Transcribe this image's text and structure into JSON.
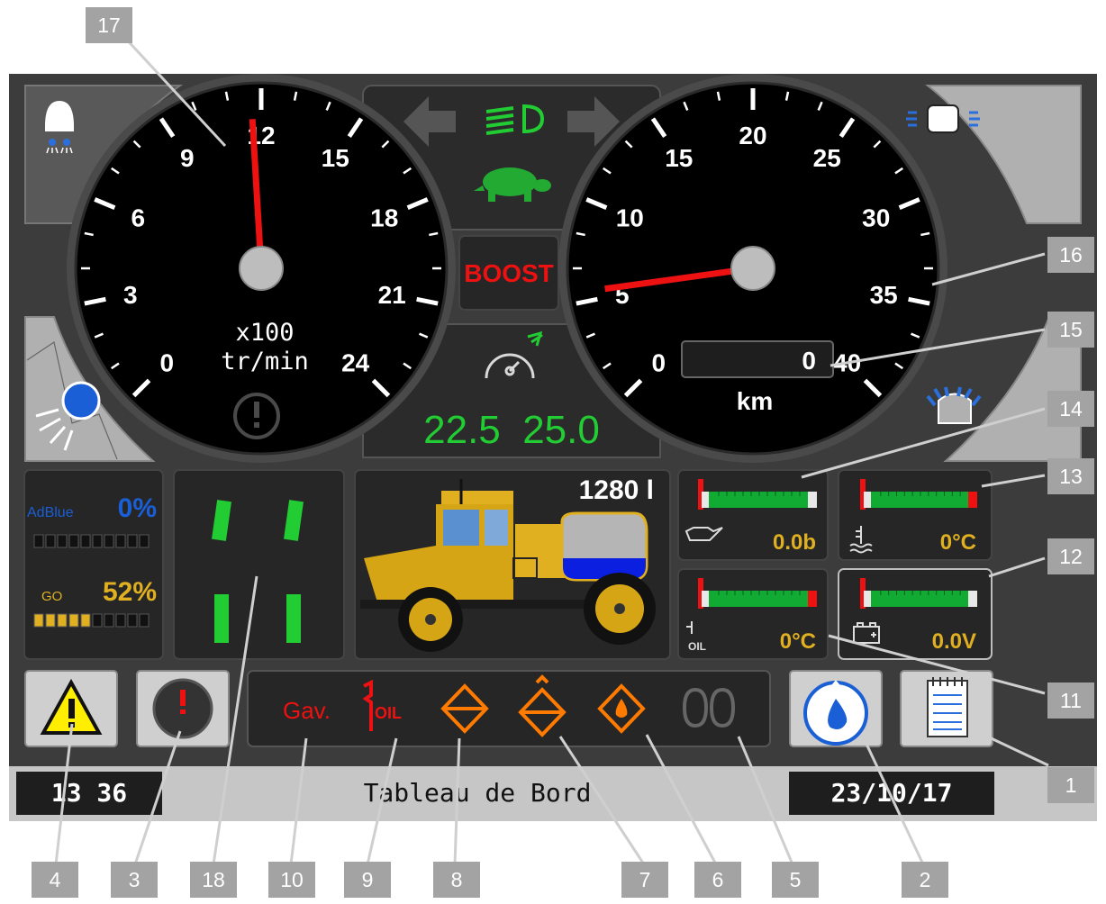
{
  "screen": {
    "title": "Tableau de Bord",
    "time": "13 36",
    "date": "23/10/17"
  },
  "rpm_gauge": {
    "unit_line1": "x100",
    "unit_line2": "tr/min",
    "ticks": [
      "0",
      "3",
      "6",
      "9",
      "12",
      "15",
      "18",
      "21",
      "24"
    ],
    "needle_value": 11.7
  },
  "speed_gauge": {
    "unit": "km",
    "odometer": "0",
    "ticks": [
      "0",
      "5",
      "10",
      "15",
      "20",
      "25",
      "30",
      "35",
      "40"
    ],
    "needle_value": 5.5
  },
  "center": {
    "boost_label": "BOOST",
    "speed_setpoints": "22.5  25.0"
  },
  "fuel_panel": {
    "adblue_label": "AdBlue",
    "adblue_value": "0%",
    "adblue_level": 0.0,
    "go_label": "GO",
    "go_value": "52%",
    "go_level": 0.52
  },
  "tank": {
    "volume": "1280 l",
    "level": 0.45
  },
  "readouts": {
    "oil_pressure": "0.0b",
    "coolant_temp": "0°C",
    "oil_temp": "0°C",
    "battery_voltage": "0.0V",
    "oil_label": "OIL"
  },
  "warnings": {
    "gav_label": "Gav.",
    "oil_label": "OIL"
  },
  "callouts": [
    "1",
    "2",
    "3",
    "4",
    "5",
    "6",
    "7",
    "8",
    "9",
    "10",
    "11",
    "12",
    "13",
    "14",
    "15",
    "16",
    "17",
    "18"
  ],
  "colors": {
    "bezel": "#3c3c3c",
    "panel": "#2e2e2e",
    "green": "#22cc33",
    "red": "#ee1111",
    "orange": "#ff7a00",
    "amber": "#e0b020",
    "blue": "#1a5fd6"
  }
}
